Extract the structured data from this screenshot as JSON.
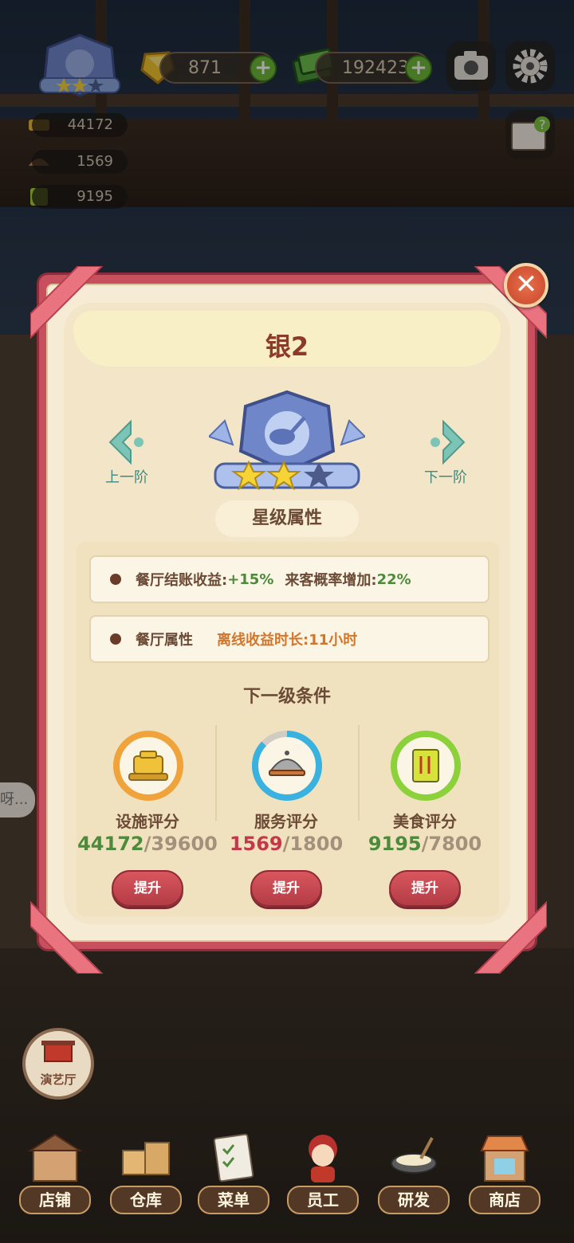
{
  "hud": {
    "gems": "871",
    "money": "192423",
    "stats": [
      "44172",
      "1569",
      "9195"
    ]
  },
  "modal": {
    "title": "银2",
    "prev_label": "上一阶",
    "next_label": "下一阶",
    "star_section": "星级属性",
    "props": {
      "row1_label1": "餐厅结账收益:",
      "row1_value1": "+15%",
      "row1_label2": "来客概率增加:",
      "row1_value2": "22%",
      "row2_label": "餐厅属性",
      "row2_value": "离线收益时长:11小时"
    },
    "next_section": "下一级条件",
    "requirements": [
      {
        "label": "设施评分",
        "current": "44172",
        "total": "/39600",
        "button": "提升",
        "color": "#f0a33a",
        "progress": 1.0
      },
      {
        "label": "服务评分",
        "current": "1569",
        "total": "/1800",
        "button": "提升",
        "color": "#3ab2e0",
        "progress": 0.87
      },
      {
        "label": "美食评分",
        "current": "9195",
        "total": "/7800",
        "button": "提升",
        "color": "#8bd23a",
        "progress": 1.0
      }
    ],
    "stars_filled": 2,
    "stars_total": 3
  },
  "bottom": {
    "theater": "演艺厅",
    "items": [
      "店铺",
      "仓库",
      "菜单",
      "员工",
      "研发",
      "商店"
    ]
  },
  "chat": "呀..."
}
